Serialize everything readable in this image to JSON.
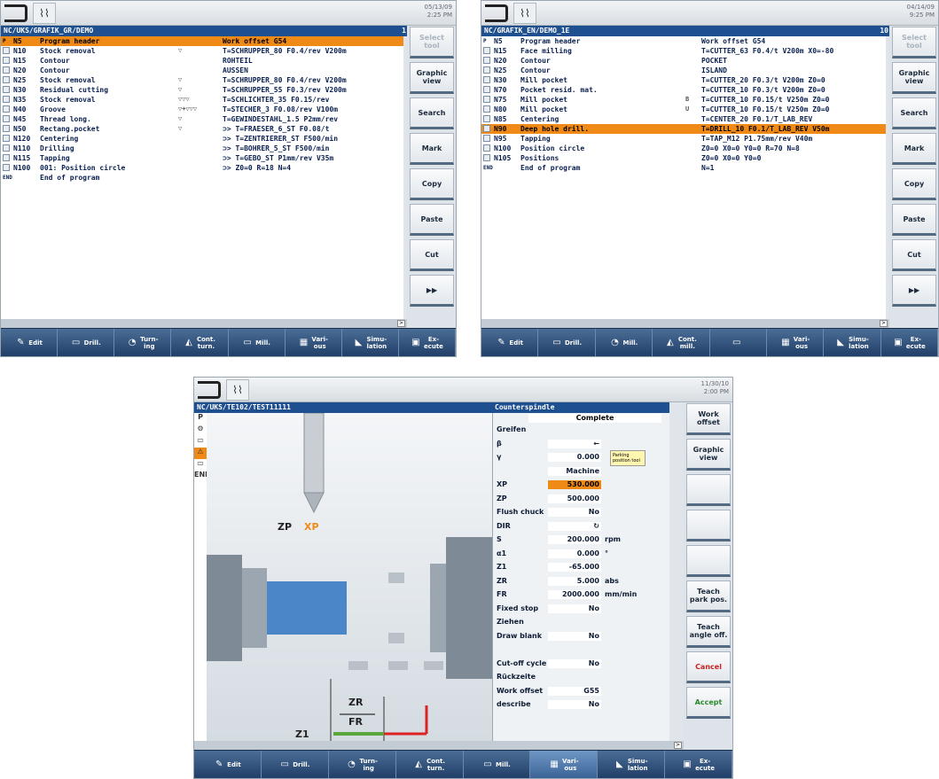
{
  "screens": [
    {
      "datetime": "05/13/09\n2:25 PM",
      "path": "NC/UKS/GRAFIK_GR/DEMO",
      "block_number": "1",
      "rows": [
        {
          "n": "P",
          "id": "N5",
          "name": "Program header",
          "param": "Work offset G54",
          "sel": true
        },
        {
          "n": "",
          "id": "N10",
          "name": "Stock removal",
          "mark": "▽",
          "param": "T=SCHRUPPER_80 F0.4/rev V200m"
        },
        {
          "n": "",
          "id": "N15",
          "name": "Contour",
          "param": "ROHTEIL"
        },
        {
          "n": "",
          "id": "N20",
          "name": "Contour",
          "param": "AUSSEN"
        },
        {
          "n": "",
          "id": "N25",
          "name": "Stock removal",
          "mark": "▽",
          "param": "T=SCHRUPPER_80 F0.4/rev V200m"
        },
        {
          "n": "",
          "id": "N30",
          "name": "Residual cutting",
          "mark": "▽",
          "param": "T=SCHRUPPER_55 F0.3/rev V200m"
        },
        {
          "n": "",
          "id": "N35",
          "name": "Stock removal",
          "mark": "▽▽▽",
          "param": "T=SCHLICHTER_35 F0.15/rev"
        },
        {
          "n": "",
          "id": "N40",
          "name": "Groove",
          "mark": "▽+▽▽▽",
          "param": "T=STECHER_3 F0.08/rev V100m"
        },
        {
          "n": "",
          "id": "N45",
          "name": "Thread long.",
          "mark": "▽",
          "param": "T=GEWINDESTAHL_1.5 P2mm/rev"
        },
        {
          "n": "",
          "id": "N50",
          "name": "Rectang.pocket",
          "mark": "▽",
          "param": "⊃> T=FRAESER_6_ST F0.08/t"
        },
        {
          "n": "",
          "id": "N120",
          "name": "Centering",
          "param": "⊃> T=ZENTRIERER_ST F500/min"
        },
        {
          "n": "",
          "id": "N110",
          "name": "Drilling",
          "param": "⊃> T=BOHRER_5_ST F500/min"
        },
        {
          "n": "",
          "id": "N115",
          "name": "Tapping",
          "param": "⊃> T=GEBO_ST P1mm/rev V35m"
        },
        {
          "n": "",
          "id": "N100",
          "name": "001: Position circle",
          "param": "⊃> Z0=0 R=18 N=4"
        },
        {
          "n": "END",
          "id": "",
          "name": "End of program",
          "param": ""
        }
      ],
      "softkeys": [
        "Select tool",
        "Graphic view",
        "Search",
        "Mark",
        "Copy",
        "Paste",
        "Cut",
        "▶▶"
      ],
      "hkeys": [
        "Edit",
        "Drill.",
        "Turn-\ning",
        "Cont.\nturn.",
        "Mill.",
        "Vari-\nous",
        "Simu-\nlation",
        "Ex-\necute"
      ]
    },
    {
      "datetime": "04/14/09\n9:25 PM",
      "path": "NC/GRAFIK_EN/DEMO_1E",
      "block_number": "10",
      "rows": [
        {
          "n": "P",
          "id": "N5",
          "name": "Program header",
          "param": "Work offset G54"
        },
        {
          "n": "",
          "id": "N15",
          "name": "Face milling",
          "param": "T=CUTTER_63 F0.4/t V200m X0=-80"
        },
        {
          "n": "",
          "id": "N20",
          "name": "Contour",
          "param": "POCKET"
        },
        {
          "n": "",
          "id": "N25",
          "name": "Contour",
          "param": "ISLAND"
        },
        {
          "n": "",
          "id": "N30",
          "name": "Mill pocket",
          "param": "T=CUTTER_20 F0.3/t V200m Z0=0"
        },
        {
          "n": "",
          "id": "N70",
          "name": "Pocket resid. mat.",
          "param": "T=CUTTER_10 F0.3/t V200m Z0=0"
        },
        {
          "n": "",
          "id": "N75",
          "name": "Mill pocket",
          "mark": "B",
          "param": "T=CUTTER_10 F0.15/t V250m Z0=0"
        },
        {
          "n": "",
          "id": "N80",
          "name": "Mill pocket",
          "mark": "U",
          "param": "T=CUTTER_10 F0.15/t V250m Z0=0"
        },
        {
          "n": "",
          "id": "N85",
          "name": "Centering",
          "param": "T=CENTER_20 F0.1/T_LAB_REV"
        },
        {
          "n": "",
          "id": "N90",
          "name": "Deep hole drill.",
          "param": "T=DRILL_10 F0.1/T_LAB_REV V50m",
          "sel": true
        },
        {
          "n": "",
          "id": "N95",
          "name": "Tapping",
          "param": "T=TAP_M12 P1.75mm/rev V40m"
        },
        {
          "n": "",
          "id": "N100",
          "name": "Position circle",
          "param": "Z0=0 X0=0 Y0=0 R=70 N=8"
        },
        {
          "n": "",
          "id": "N105",
          "name": "Positions",
          "param": "Z0=0 X0=0 Y0=0"
        },
        {
          "n": "END",
          "id": "",
          "name": "End of program",
          "param": "N=1"
        }
      ],
      "softkeys": [
        "Select tool",
        "Graphic view",
        "Search",
        "Mark",
        "Copy",
        "Paste",
        "Cut",
        "▶▶"
      ],
      "hkeys": [
        "Edit",
        "Drill.",
        "Mill.",
        "Cont.\nmill.",
        "",
        "Vari-\nous",
        "Simu-\nlation",
        "Ex-\necute"
      ]
    },
    {
      "datetime": "11/30/10\n2:00 PM",
      "path": "NC/UKS/TE102/TEST11111",
      "form_title": "Counterspindle",
      "mode": "Complete",
      "graphic_labels": {
        "zp": "ZP",
        "xp": "XP",
        "zr": "ZR",
        "fr": "FR",
        "z1": "Z1"
      },
      "tooltip": "Parking position tool",
      "params": [
        {
          "label": "Greifen",
          "value": "",
          "unit": ""
        },
        {
          "label": "β",
          "value": "←",
          "unit": ""
        },
        {
          "label": "γ",
          "value": "0.000",
          "unit": ""
        },
        {
          "label": "",
          "value": "Machine",
          "unit": ""
        },
        {
          "label": "XP",
          "value": "530.000",
          "unit": "",
          "sel": true
        },
        {
          "label": "ZP",
          "value": "500.000",
          "unit": ""
        },
        {
          "label": "Flush chuck",
          "value": "No",
          "unit": ""
        },
        {
          "label": "DIR",
          "value": "↻",
          "unit": ""
        },
        {
          "label": "S",
          "value": "200.000",
          "unit": "rpm"
        },
        {
          "label": "α1",
          "value": "0.000",
          "unit": "°"
        },
        {
          "label": "Z1",
          "value": "-65.000",
          "unit": ""
        },
        {
          "label": "ZR",
          "value": "5.000",
          "unit": "abs"
        },
        {
          "label": "FR",
          "value": "2000.000",
          "unit": "mm/min"
        },
        {
          "label": "Fixed stop",
          "value": "No",
          "unit": ""
        },
        {
          "label": "Ziehen",
          "value": "",
          "unit": ""
        },
        {
          "label": "Draw blank",
          "value": "No",
          "unit": ""
        },
        {
          "label": "",
          "value": "",
          "unit": ""
        },
        {
          "label": "Cut-off cycle",
          "value": "No",
          "unit": ""
        },
        {
          "label": "Rückzeite",
          "value": "",
          "unit": ""
        },
        {
          "label": "Work offset",
          "value": "G55",
          "unit": ""
        },
        {
          "label": "describe",
          "value": "No",
          "unit": ""
        }
      ],
      "side_icons": [
        "P",
        "⚙",
        "▭",
        "⚠",
        "▭",
        "END"
      ],
      "softkeys": [
        "Work offset",
        "Graphic view",
        "",
        "",
        "",
        "Teach park pos.",
        "Teach angle off.",
        "Cancel",
        "Accept"
      ],
      "hkeys": [
        "Edit",
        "Drill.",
        "Turn-\ning",
        "Cont.\nturn.",
        "Mill.",
        "Vari-\nous",
        "Simu-\nlation",
        "Ex-\necute"
      ]
    }
  ],
  "colors": {
    "accent": "#f08a17",
    "path_blue": "#1e4f8f",
    "hotkey_bar": "#2c4c78"
  },
  "icons": {
    "back": "back-arrow-icon",
    "machine": "machine-area-icon"
  }
}
